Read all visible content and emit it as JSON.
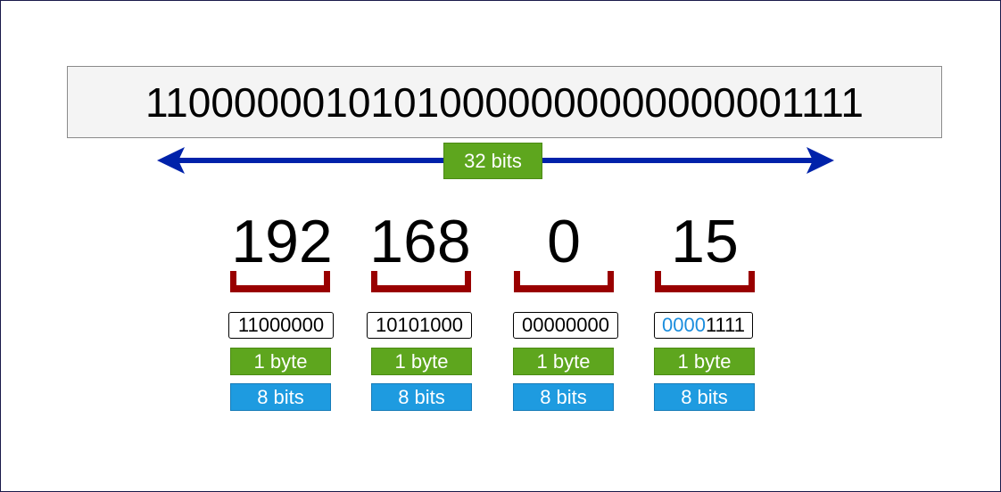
{
  "full_binary": "11000000101010000000000000001111",
  "total_label": "32 bits",
  "colors": {
    "arrow": "#0022aa",
    "bracket": "#990000",
    "byte_green": "#5ea61e",
    "bits_blue": "#1e9be0",
    "highlight_blue": "#1b8ede"
  },
  "octets": [
    {
      "decimal": "192",
      "binary_highlight": "",
      "binary_rest": "11000000",
      "byte_label": "1 byte",
      "bits_label": "8 bits"
    },
    {
      "decimal": "168",
      "binary_highlight": "",
      "binary_rest": "10101000",
      "byte_label": "1 byte",
      "bits_label": "8 bits"
    },
    {
      "decimal": "0",
      "binary_highlight": "",
      "binary_rest": "00000000",
      "byte_label": "1 byte",
      "bits_label": "8 bits"
    },
    {
      "decimal": "15",
      "binary_highlight": "0000",
      "binary_rest": "1111",
      "byte_label": "1 byte",
      "bits_label": "8 bits"
    }
  ]
}
